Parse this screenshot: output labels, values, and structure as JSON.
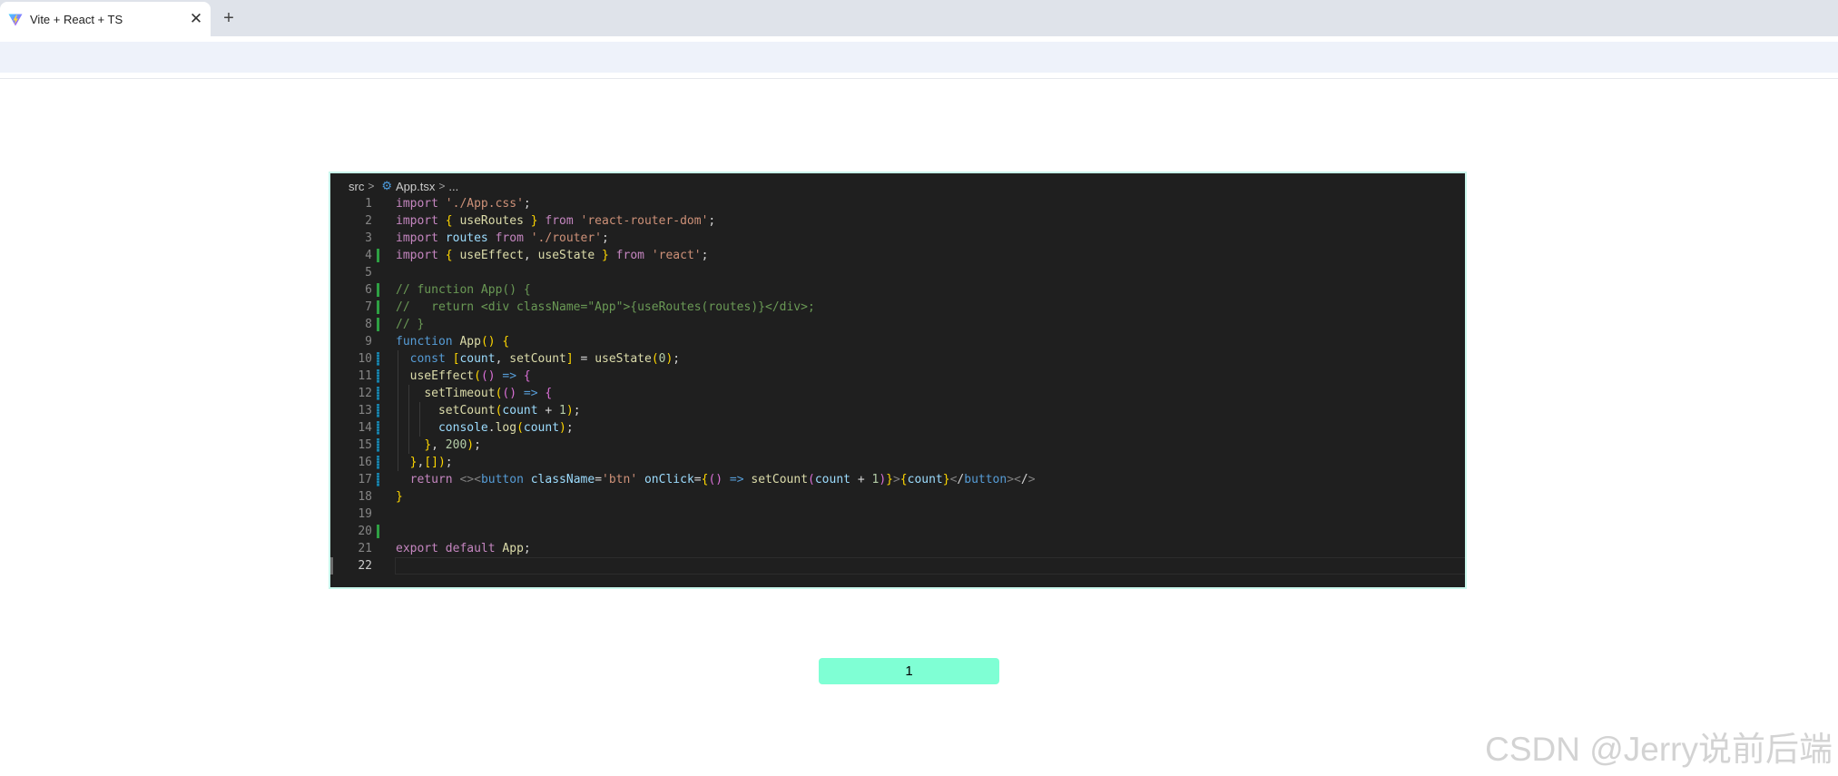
{
  "browser": {
    "tab_title": "Vite + React + TS",
    "close_glyph": "✕",
    "new_tab_glyph": "+"
  },
  "editor": {
    "breadcrumb": {
      "folder": "src",
      "file": "App.tsx",
      "more": "..."
    },
    "line_numbers": [
      "1",
      "2",
      "3",
      "4",
      "5",
      "6",
      "7",
      "8",
      "9",
      "10",
      "11",
      "12",
      "13",
      "14",
      "15",
      "16",
      "17",
      "18",
      "19",
      "20",
      "21",
      "22"
    ],
    "code_lines": [
      "import './App.css';",
      "import { useRoutes } from 'react-router-dom';",
      "import routes from './router';",
      "import { useEffect, useState } from 'react';",
      "",
      "// function App() {",
      "//   return <div className=\"App\">{useRoutes(routes)}</div>;",
      "// }",
      "function App() {",
      "  const [count, setCount] = useState(0);",
      "  useEffect(() => {",
      "    setTimeout(() => {",
      "      setCount(count + 1);",
      "      console.log(count);",
      "    }, 200);",
      "  },[]);",
      "  return <><button className='btn' onClick={() => setCount(count + 1)}>{count}</button></>",
      "}",
      "",
      "",
      "export default App;",
      ""
    ],
    "active_line": "22",
    "gutter_colors": {
      "added": "#2ea043",
      "modified": "#1b81a8"
    }
  },
  "app": {
    "count_button_label": "1",
    "button_color": "#7fffd4"
  },
  "watermark": "CSDN @Jerry说前后端",
  "icons": {
    "tab_logo": "vite-logo-icon",
    "file_icon": "react-gear-icon"
  }
}
